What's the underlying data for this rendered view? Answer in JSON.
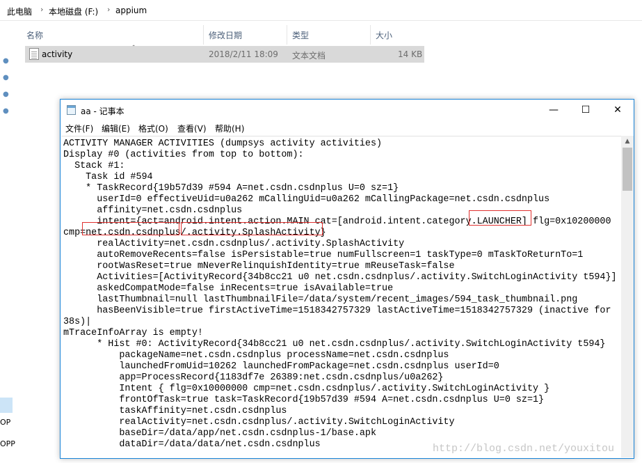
{
  "explorer": {
    "breadcrumb": [
      "此电脑",
      "本地磁盘 (F:)",
      "appium"
    ],
    "breadcrumb_separator": "›",
    "columns": {
      "name": "名称",
      "modified": "修改日期",
      "type": "类型",
      "size": "大小",
      "sort_indicator": "^"
    },
    "file": {
      "name": "activity",
      "modified": "2018/2/11 18:09",
      "type": "文本文档",
      "size": "14 KB"
    },
    "pin_icon": "pin-icon",
    "left_fragments": [
      "OP",
      "OPP"
    ]
  },
  "notepad": {
    "title": "aa - 记事本",
    "controls": {
      "minimize": "—",
      "maximize": "☐",
      "close": "✕"
    },
    "menu": [
      {
        "label": "文件(F)"
      },
      {
        "label": "编辑(E)"
      },
      {
        "label": "格式(O)"
      },
      {
        "label": "查看(V)"
      },
      {
        "label": "帮助(H)"
      }
    ],
    "lines": [
      "ACTIVITY MANAGER ACTIVITIES (dumpsys activity activities)",
      "Display #0 (activities from top to bottom):",
      "  Stack #1:",
      "    Task id #594",
      "    * TaskRecord{19b57d39 #594 A=net.csdn.csdnplus U=0 sz=1}",
      "      userId=0 effectiveUid=u0a262 mCallingUid=u0a262 mCallingPackage=net.csdn.csdnplus",
      "      affinity=net.csdn.csdnplus",
      "      intent={act=android.intent.action.MAIN cat=[android.intent.category.LAUNCHER] flg=0x10200000",
      "cmp=net.csdn.csdnplus/.activity.SplashActivity}",
      "      realActivity=net.csdn.csdnplus/.activity.SplashActivity",
      "      autoRemoveRecents=false isPersistable=true numFullscreen=1 taskType=0 mTaskToReturnTo=1",
      "      rootWasReset=true mNeverRelinquishIdentity=true mReuseTask=false",
      "      Activities=[ActivityRecord{34b8cc21 u0 net.csdn.csdnplus/.activity.SwitchLoginActivity t594}]",
      "      askedCompatMode=false inRecents=true isAvailable=true",
      "      lastThumbnail=null lastThumbnailFile=/data/system/recent_images/594_task_thumbnail.png",
      "      hasBeenVisible=true firstActiveTime=1518342757329 lastActiveTime=1518342757329 (inactive for",
      "38s)|",
      "mTraceInfoArray is empty!",
      "      * Hist #0: ActivityRecord{34b8cc21 u0 net.csdn.csdnplus/.activity.SwitchLoginActivity t594}",
      "          packageName=net.csdn.csdnplus processName=net.csdn.csdnplus",
      "          launchedFromUid=10262 launchedFromPackage=net.csdn.csdnplus userId=0",
      "          app=ProcessRecord{1183df7e 26389:net.csdn.csdnplus/u0a262}",
      "          Intent { flg=0x10000000 cmp=net.csdn.csdnplus/.activity.SwitchLoginActivity }",
      "          frontOfTask=true task=TaskRecord{19b57d39 #594 A=net.csdn.csdnplus U=0 sz=1}",
      "          taskAffinity=net.csdn.csdnplus",
      "          realActivity=net.csdn.csdnplus/.activity.SwitchLoginActivity",
      "          baseDir=/data/app/net.csdn.csdnplus-1/base.apk",
      "          dataDir=/data/data/net.csdn.csdnplus"
    ],
    "highlight_color": "#e0312f"
  },
  "watermark": "http://blog.csdn.net/youxitou"
}
